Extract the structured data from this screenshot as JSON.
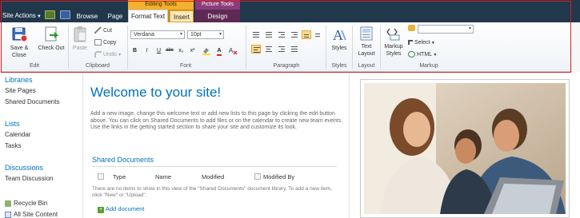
{
  "topbar": {
    "site_actions": "Site Actions",
    "tabs": {
      "browse": "Browse",
      "page": "Page",
      "format_text": "Format Text",
      "insert": "Insert",
      "design": "Design"
    },
    "contextual": {
      "editing_tools": "Editing Tools",
      "picture_tools": "Picture Tools"
    }
  },
  "ribbon": {
    "edit": {
      "save_close": "Save & Close",
      "check_out": "Check Out",
      "label": "Edit"
    },
    "clipboard": {
      "paste": "Paste",
      "cut": "Cut",
      "copy": "Copy",
      "undo": "Undo",
      "label": "Clipboard"
    },
    "font": {
      "font_name": "Verdana",
      "font_size": "10pt",
      "label": "Font",
      "bold": "B",
      "italic": "I",
      "underline": "U",
      "strike": "abc",
      "subscript": "x₂",
      "superscript": "x²",
      "clear": "A"
    },
    "paragraph": {
      "label": "Paragraph"
    },
    "styles": {
      "styles": "Styles",
      "label": "Styles"
    },
    "layout": {
      "text_layout": "Text Layout",
      "label": "Layout"
    },
    "markup": {
      "markup_styles": "Markup Styles",
      "select": "Select",
      "html": "HTML",
      "label": "Markup",
      "dropdown_value": ""
    }
  },
  "left_nav": {
    "libraries": "Libraries",
    "site_pages": "Site Pages",
    "shared_documents": "Shared Documents",
    "lists": "Lists",
    "calendar": "Calendar",
    "tasks": "Tasks",
    "discussions": "Discussions",
    "team_discussion": "Team Discussion",
    "recycle_bin": "Recycle Bin",
    "all_site_content": "All Site Content"
  },
  "main": {
    "title": "Welcome to your site!",
    "intro": "Add a new image, change this welcome text or add new lists to this page by clicking the edit button above. You can click on Shared Documents to add files or on the calendar to create new team events. Use the links in the getting started section to share your site and customize its look.",
    "library": {
      "title": "Shared Documents",
      "columns": {
        "type": "Type",
        "name": "Name",
        "modified": "Modified",
        "modified_by": "Modified By"
      },
      "empty_message": "There are no items to show in this view of the \"Shared Documents\" document library. To add a new item, click \"New\" or \"Upload\".",
      "add_document": "Add document"
    }
  },
  "colors": {
    "topbar": "#21374c",
    "editing_tools": "#f4b02e",
    "picture_tools": "#8b3d7a",
    "link_blue": "#0072bc",
    "outline_red": "#d81e1e"
  },
  "icons": [
    "navigate-up-icon",
    "edit-page-icon",
    "save-icon",
    "check-out-icon",
    "paste-icon",
    "cut-icon",
    "copy-icon",
    "undo-icon",
    "styles-icon",
    "text-layout-icon",
    "markup-styles-icon",
    "select-icon",
    "html-icon",
    "recycle-bin-icon",
    "all-site-content-icon",
    "add-icon"
  ]
}
